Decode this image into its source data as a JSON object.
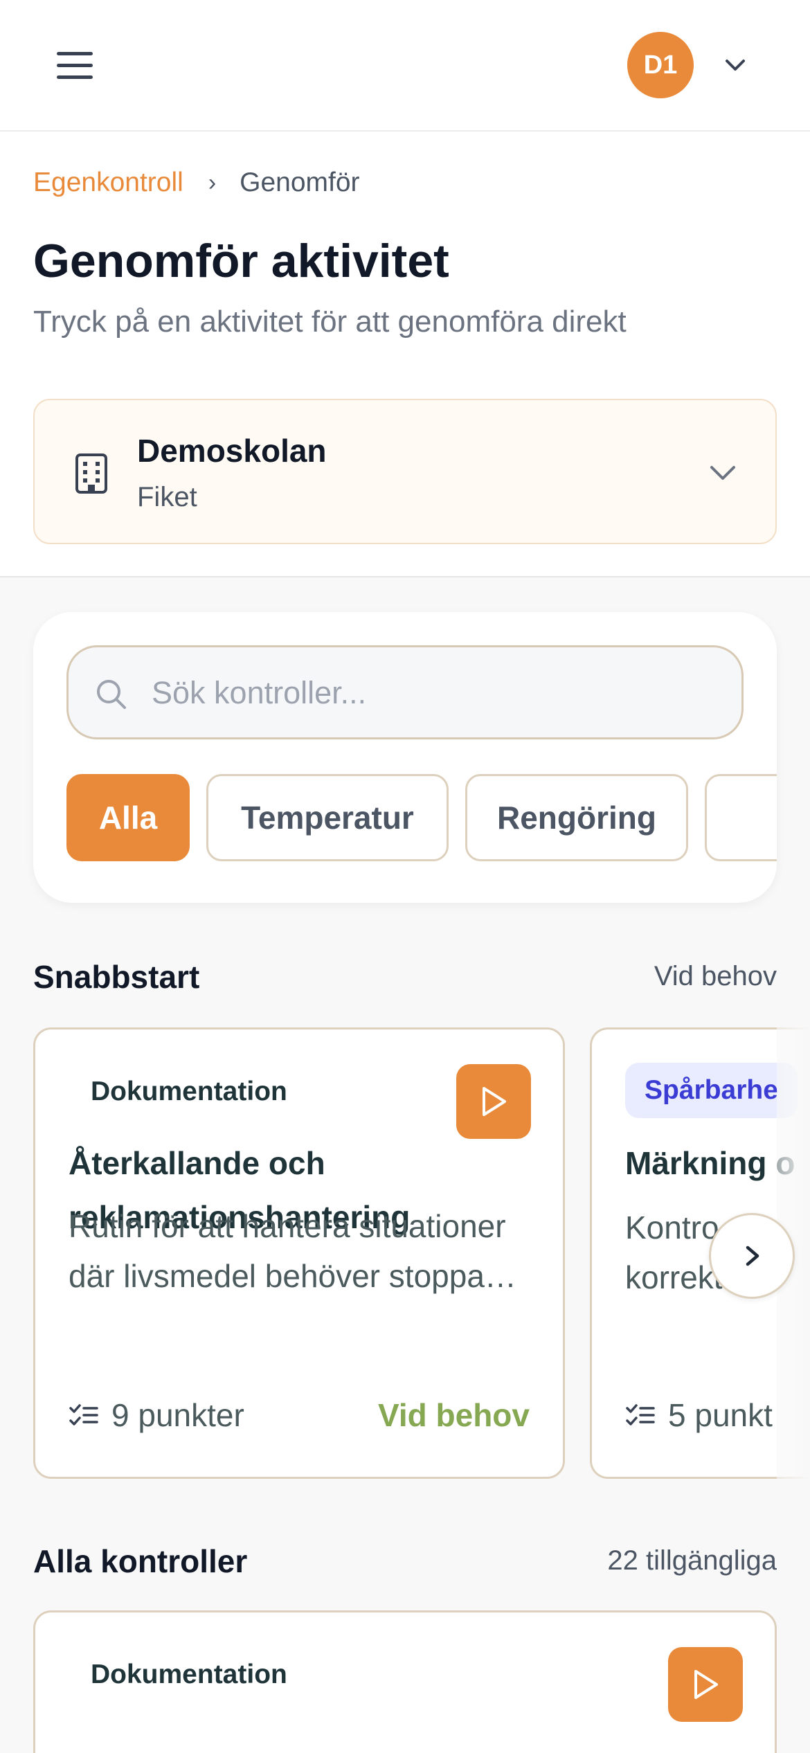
{
  "header": {
    "avatar_initials": "D1",
    "accent": "#e98a3b"
  },
  "breadcrumb": {
    "root": "Egenkontroll",
    "separator": "›",
    "current": "Genomför"
  },
  "page": {
    "title": "Genomför aktivitet",
    "subtitle": "Tryck på en aktivitet för att genomföra direkt"
  },
  "location": {
    "name": "Demoskolan",
    "unit": "Fiket",
    "icon": "building-icon"
  },
  "search": {
    "placeholder": "Sök kontroller..."
  },
  "filters": [
    {
      "label": "Alla",
      "active": true
    },
    {
      "label": "Temperatur",
      "active": false
    },
    {
      "label": "Rengöring",
      "active": false
    },
    {
      "label": "",
      "active": false
    }
  ],
  "quickstart": {
    "heading": "Snabbstart",
    "right": "Vid behov",
    "cards": [
      {
        "category": "Dokumentation",
        "title_lines": [
          "Återkallande och",
          "reklamationshantering"
        ],
        "desc_lines": [
          "Rutin för att hantera situationer",
          "där livsmedel behöver stoppa…"
        ],
        "points": "9 punkter",
        "frequency": "Vid behov"
      },
      {
        "category": "Spårbarhe",
        "title_lines": [
          "Märkning o"
        ],
        "desc_lines": [
          "Kontro",
          "korrekt m"
        ],
        "points": "5 punkt",
        "frequency": ""
      }
    ]
  },
  "all_controls": {
    "heading": "Alla kontroller",
    "count": "22 tillgängliga",
    "cards": [
      {
        "category": "Dokumentation"
      }
    ]
  }
}
